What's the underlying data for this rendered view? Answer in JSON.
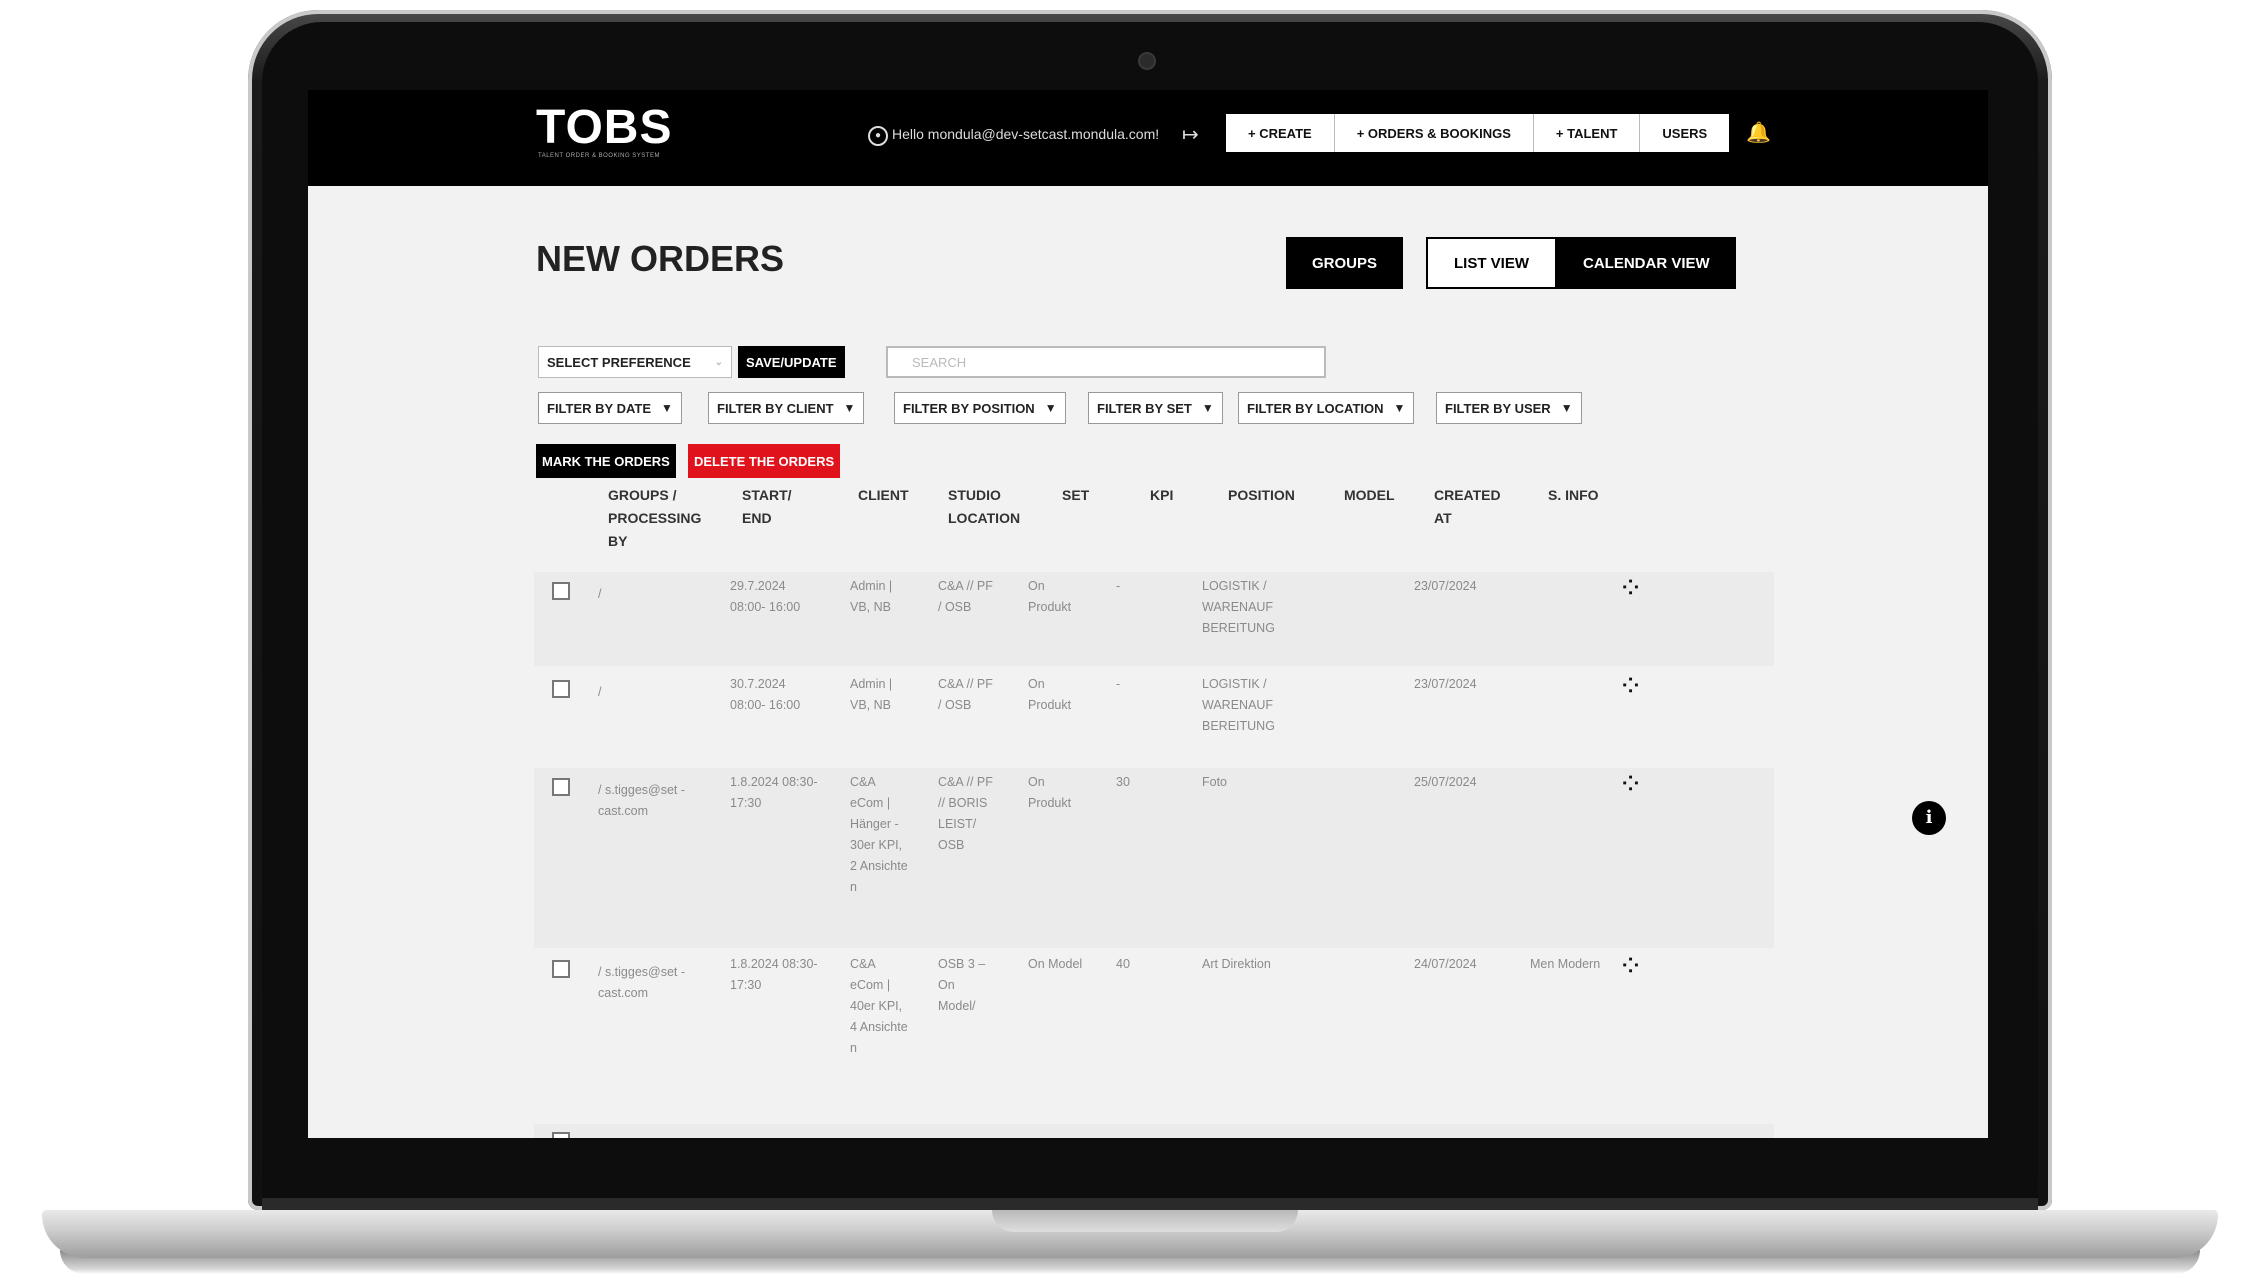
{
  "header": {
    "logo": "TOBS",
    "logo_tagline": "TALENT ORDER & BOOKING SYSTEM",
    "user_greeting": "Hello mondula@dev-setcast.mondula.com!",
    "nav": [
      "+ CREATE",
      "+ ORDERS & BOOKINGS",
      "+ TALENT",
      "USERS"
    ]
  },
  "page": {
    "title": "NEW ORDERS",
    "groups_label": "GROUPS",
    "list_view_label": "LIST VIEW",
    "calendar_view_label": "CALENDAR VIEW"
  },
  "toolbar": {
    "preference_value": "SELECT PREFERENCE",
    "save_label": "SAVE/UPDATE",
    "search_placeholder": "SEARCH",
    "filters": [
      "FILTER BY DATE",
      "FILTER BY CLIENT",
      "FILTER BY POSITION",
      "FILTER BY SET",
      "FILTER BY LOCATION",
      "FILTER BY USER"
    ],
    "mark_label": "MARK THE ORDERS",
    "delete_label": "DELETE THE ORDERS"
  },
  "table": {
    "headers": [
      "GROUPS / PROCESSING BY",
      "START/ END",
      "CLIENT",
      "STUDIO LOCATION",
      "SET",
      "KPI",
      "POSITION",
      "MODEL",
      "CREATED AT",
      "S. INFO"
    ],
    "rows": [
      {
        "group": "/",
        "start": "29.7.2024 08:00- 16:00",
        "client": "Admin | VB, NB",
        "location": "C&A // PF / OSB",
        "set": "On Produkt",
        "kpi": "-",
        "position": "LOGISTIK / WARENAUF BEREITUNG",
        "model": "",
        "created": "23/07/2024",
        "info": ""
      },
      {
        "group": "/",
        "start": "30.7.2024 08:00- 16:00",
        "client": "Admin | VB, NB",
        "location": "C&A // PF / OSB",
        "set": "On Produkt",
        "kpi": "-",
        "position": "LOGISTIK / WARENAUF BEREITUNG",
        "model": "",
        "created": "23/07/2024",
        "info": ""
      },
      {
        "group": "/ s.tigges@set -cast.com",
        "start": "1.8.2024 08:30- 17:30",
        "client": "C&A eCom | Hänger - 30er KPI, 2 Ansichte n",
        "location": "C&A // PF // BORIS LEIST/ OSB",
        "set": "On Produkt",
        "kpi": "30",
        "position": "Foto",
        "model": "",
        "created": "25/07/2024",
        "info": ""
      },
      {
        "group": "/ s.tigges@set -cast.com",
        "start": "1.8.2024 08:30- 17:30",
        "client": "C&A eCom | 40er KPI, 4 Ansichte n",
        "location": "OSB 3 – On Model/",
        "set": "On Model",
        "kpi": "40",
        "position": "Art Direktion",
        "model": "",
        "created": "24/07/2024",
        "info": "Men Modern"
      }
    ]
  },
  "icons": {
    "user": "user-circle-icon",
    "logout": "logout-icon",
    "notifications": "bell-icon",
    "row_action": "people-group-icon",
    "info": "info-icon"
  }
}
